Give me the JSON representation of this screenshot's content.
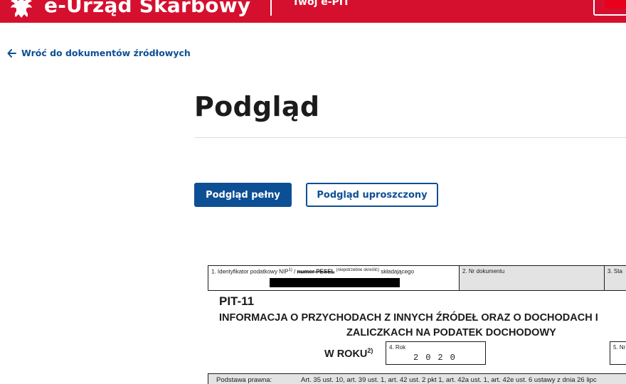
{
  "header": {
    "brand": "e-Urząd Skarbowy",
    "service": "Twój e-PIT",
    "brand_color": "#d5102f",
    "icons": [
      "eagle-emblem-icon"
    ]
  },
  "back_link": {
    "label": "Wróć do dokumentów źródłowych",
    "icon": "arrow-left-icon"
  },
  "page": {
    "title": "Podgląd"
  },
  "actions": {
    "full_preview": "Podgląd pełny",
    "simplified_preview": "Podgląd uproszczony",
    "accent_color": "#0d4f94"
  },
  "form": {
    "field1": {
      "label_prefix": "1. Identyfikator podatkowy NIP",
      "sup1": "1)",
      "slash": " / ",
      "struck": "numer PESEL",
      "note": "(niepotrzebne skreślić)",
      "suffix": " składającego"
    },
    "field2_label": "2. Nr dokumentu",
    "field3_label": "3. Sta",
    "form_code": "PIT-11",
    "heading_line1": "INFORMACJA O PRZYCHODACH Z INNYCH ŹRÓDEŁ ORAZ O DOCHODACH I",
    "heading_line2": "ZALICZKACH NA PODATEK DOCHODOWY",
    "w_roku": "W ROKU",
    "w_roku_sup": "2)",
    "field4_label": "4. Rok",
    "year": "2020",
    "field5_label": "5. Nr",
    "legal_basis_label": "Podstawa prawna:",
    "legal_basis_text": "Art. 35 ust. 10, art. 39 ust. 1, art. 42 ust. 2 pkt 1, art. 42a ust. 1, art. 42e ust. 6 ustawy z dnia 26 lipc"
  }
}
